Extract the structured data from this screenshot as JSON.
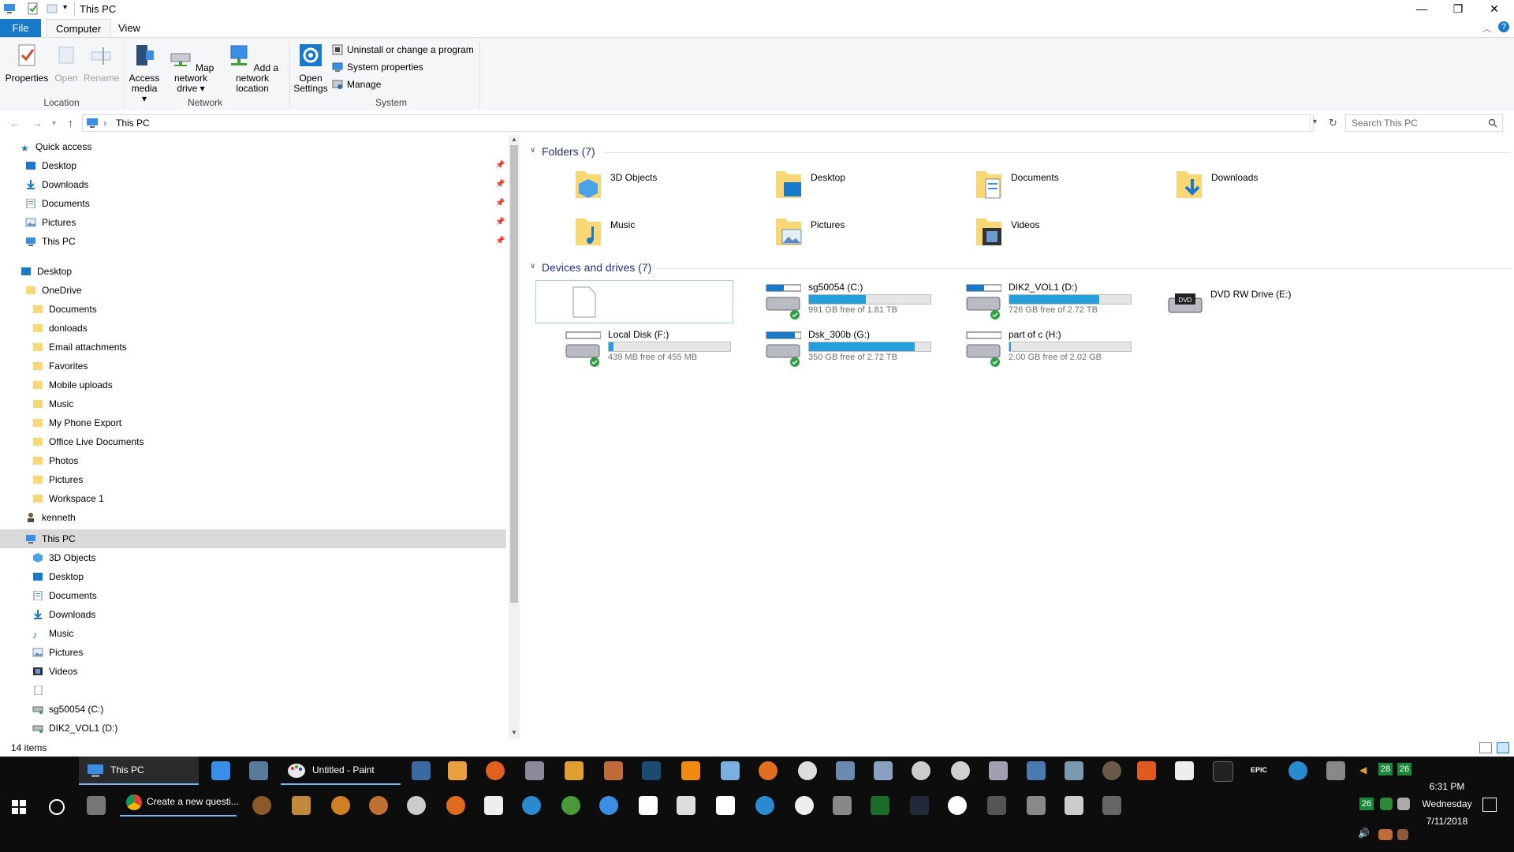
{
  "window": {
    "title": "This PC",
    "controls": {
      "minimize": "—",
      "restore": "❐",
      "close": "✕",
      "help": "?"
    }
  },
  "ribbon": {
    "tabs": {
      "file": "File",
      "computer": "Computer",
      "view": "View"
    },
    "location": {
      "properties": "Properties",
      "open": "Open",
      "rename": "Rename",
      "group": "Location"
    },
    "network": {
      "access_media_1": "Access",
      "access_media_2": "media ▾",
      "map_drive_1": "Map network",
      "map_drive_2": "drive ▾",
      "add_location_1": "Add a network",
      "add_location_2": "location",
      "group": "Network"
    },
    "system": {
      "open_settings_1": "Open",
      "open_settings_2": "Settings",
      "uninstall": "Uninstall or change a program",
      "system_properties": "System properties",
      "manage": "Manage",
      "group": "System"
    }
  },
  "address": {
    "path": "This PC",
    "separator": "›",
    "search_placeholder": "Search This PC"
  },
  "nav": {
    "quick_access": "Quick access",
    "quick": [
      "Desktop",
      "Downloads",
      "Documents",
      "Pictures",
      "This PC"
    ],
    "desktop": "Desktop",
    "onedrive": "OneDrive",
    "onedrive_items": [
      "Documents",
      "donloads",
      "Email attachments",
      "Favorites",
      "Mobile uploads",
      "Music",
      "My Phone Export",
      "Office Live Documents",
      "Photos",
      "Pictures",
      "Workspace 1"
    ],
    "user": "kenneth",
    "this_pc": "This PC",
    "this_pc_items": [
      "3D Objects",
      "Desktop",
      "Documents",
      "Downloads",
      "Music",
      "Pictures",
      "Videos"
    ],
    "drives": [
      "sg50054 (C:)",
      "DIK2_VOL1 (D:)"
    ]
  },
  "content": {
    "folders_header": "Folders (7)",
    "folders": [
      {
        "name": "3D Objects"
      },
      {
        "name": "Desktop"
      },
      {
        "name": "Documents"
      },
      {
        "name": "Downloads"
      },
      {
        "name": "Music"
      },
      {
        "name": "Pictures"
      },
      {
        "name": "Videos"
      }
    ],
    "devices_header": "Devices and drives (7)",
    "drives": [
      {
        "name": "sg50054 (C:)",
        "free": "991 GB free of 1.81 TB",
        "used_fraction": 0.47
      },
      {
        "name": "DIK2_VOL1 (D:)",
        "free": "726 GB free of 2.72 TB",
        "used_fraction": 0.74
      },
      {
        "name": "Local Disk (F:)",
        "free": "439 MB free of 455 MB",
        "used_fraction": 0.04
      },
      {
        "name": "Dsk_300b (G:)",
        "free": "350 GB free of 2.72 TB",
        "used_fraction": 0.87
      },
      {
        "name": "part of c (H:)",
        "free": "2.00 GB free of 2.02 GB",
        "used_fraction": 0.01
      }
    ],
    "dvd": {
      "name": "DVD RW Drive (E:)",
      "badge": "DVD"
    }
  },
  "status": {
    "items": "14 items"
  },
  "taskbar": {
    "windows": {
      "this_pc": "This PC",
      "paint": "Untitled - Paint",
      "chrome": "Create a new questi..."
    },
    "tray": {
      "battery1": "28",
      "battery2": "26",
      "battery3": "26"
    },
    "clock": {
      "time": "6:31 PM",
      "day": "Wednesday",
      "date": "7/11/2018"
    },
    "epic": "EPIC"
  },
  "colors": {
    "accent": "#1979ca",
    "folder": "#f8d775",
    "drive_bar": "#26a0da",
    "selection": "#d9d9d9",
    "taskbar": "#0d0d0e"
  }
}
